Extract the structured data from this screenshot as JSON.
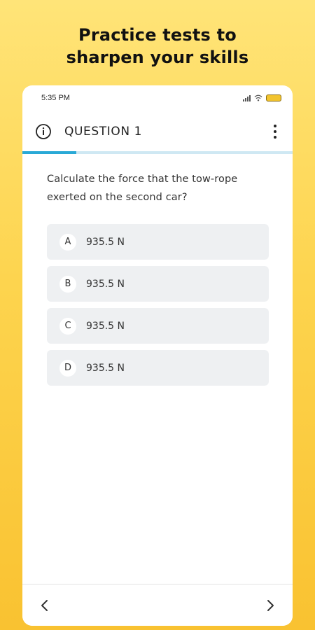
{
  "banner": {
    "line1": "Practice tests to",
    "line2": "sharpen your skills"
  },
  "status": {
    "time": "5:35 PM"
  },
  "header": {
    "title": "QUESTION 1",
    "progress": 0.2
  },
  "question": {
    "text": "Calculate the force that the tow-rope exerted on the second car?"
  },
  "options": [
    {
      "letter": "A",
      "text": "935.5 N"
    },
    {
      "letter": "B",
      "text": "935.5 N"
    },
    {
      "letter": "C",
      "text": "935.5 N"
    },
    {
      "letter": "D",
      "text": "935.5 N"
    }
  ],
  "icons": {
    "info": "info-icon",
    "more": "more-vertical-icon",
    "prev": "chevron-left-icon",
    "next": "chevron-right-icon"
  },
  "colors": {
    "accent": "#29A9D6",
    "background": "#FDD44E",
    "option_bg": "#EEF0F2"
  }
}
